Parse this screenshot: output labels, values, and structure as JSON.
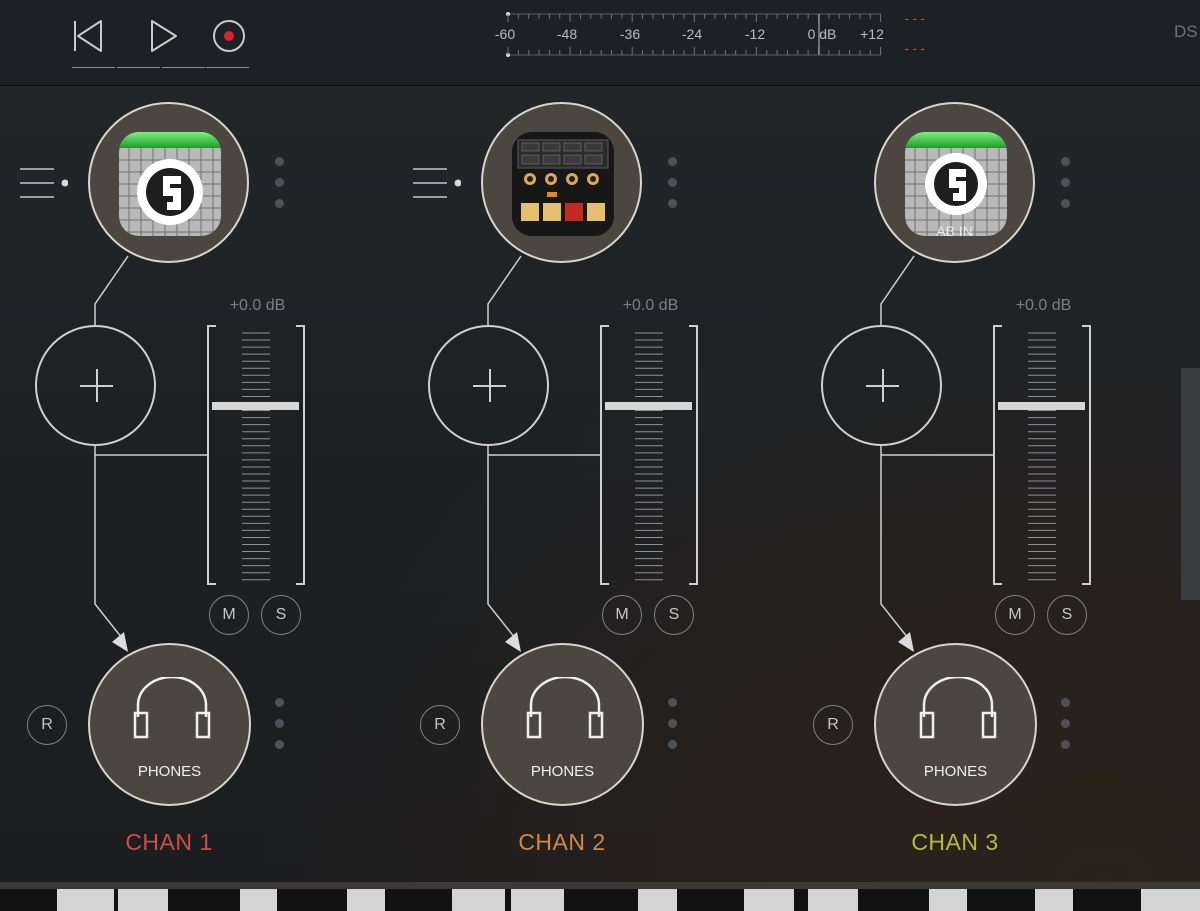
{
  "transport": {
    "buttons": [
      {
        "name": "rewind",
        "icon": "rewind-icon"
      },
      {
        "name": "play",
        "icon": "play-icon"
      },
      {
        "name": "record",
        "icon": "record-icon"
      }
    ]
  },
  "meter": {
    "labels": [
      "-60",
      "-48",
      "-36",
      "-24",
      "-12",
      "0 dB",
      "+12"
    ],
    "peak_left": "---",
    "peak_right": "---"
  },
  "ds_label": "DS",
  "colors": {
    "accent_record": "#d4262a",
    "chan1": "#d04c46",
    "chan2": "#d38743",
    "chan3": "#b9b843",
    "plugin_green": "#35d24a",
    "peak": "#c8581c"
  },
  "channels": [
    {
      "plugin": {
        "icon": "audiobus-icon",
        "name": ""
      },
      "gain": "+0.0 dB",
      "mute_label": "M",
      "solo_label": "S",
      "record_label": "R",
      "output": {
        "icon": "headphones-icon",
        "label": "PHONES"
      },
      "name": "CHAN 1"
    },
    {
      "plugin": {
        "icon": "drum-machine-icon",
        "name": ""
      },
      "gain": "+0.0 dB",
      "mute_label": "M",
      "solo_label": "S",
      "record_label": "R",
      "output": {
        "icon": "headphones-icon",
        "label": "PHONES"
      },
      "name": "CHAN 2"
    },
    {
      "plugin": {
        "icon": "audiobus-icon",
        "name": "AB IN"
      },
      "gain": "+0.0 dB",
      "mute_label": "M",
      "solo_label": "S",
      "record_label": "R",
      "output": {
        "icon": "headphones-icon",
        "label": "PHONES"
      },
      "name": "CHAN 3"
    }
  ]
}
